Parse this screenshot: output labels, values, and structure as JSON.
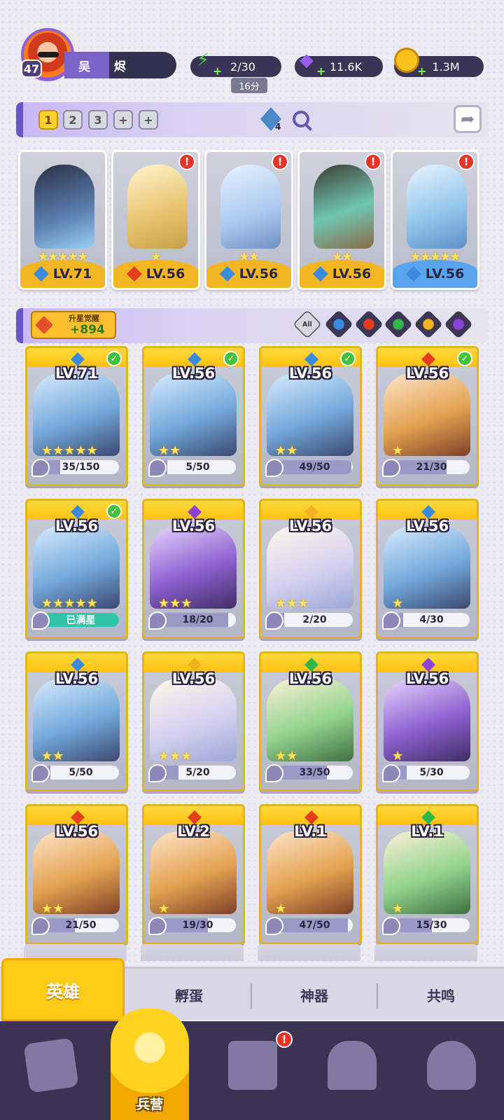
{
  "player": {
    "level": "47",
    "name": "吴 烬"
  },
  "resources": {
    "stamina": "2/30",
    "stamina_timer": "16分",
    "gems": "11.6K",
    "coins": "1.3M"
  },
  "team": {
    "tabs": [
      "1",
      "2",
      "3",
      "+",
      "+"
    ],
    "gem_count": "4",
    "cards": [
      {
        "level": "LV.71",
        "stars": "★★★★★",
        "element": "water",
        "alert": false
      },
      {
        "level": "LV.56",
        "stars": "★",
        "element": "fire",
        "alert": true
      },
      {
        "level": "LV.56",
        "stars": "★★",
        "element": "water",
        "alert": true
      },
      {
        "level": "LV.56",
        "stars": "★★",
        "element": "water",
        "alert": true
      },
      {
        "level": "LV.56",
        "stars": "★★★★★",
        "element": "water",
        "alert": true
      }
    ]
  },
  "awaken": {
    "label": "升星觉醒",
    "value": "+894"
  },
  "filters": {
    "all_label": "All",
    "elements": [
      "water",
      "fire",
      "earth",
      "light",
      "dark"
    ]
  },
  "colors": {
    "water": "#3a8ae0",
    "fire": "#e43e1c",
    "earth": "#2eb84a",
    "light": "#f0b31f",
    "dark": "#8a43d9"
  },
  "heroes": [
    {
      "level": "LV.71",
      "element": "water",
      "progress": "35/150",
      "fill": 0.23,
      "checked": true,
      "stars": "★★★★★"
    },
    {
      "level": "LV.56",
      "element": "water",
      "progress": "5/50",
      "fill": 0.1,
      "checked": true,
      "stars": "★★"
    },
    {
      "level": "LV.56",
      "element": "water",
      "progress": "49/50",
      "fill": 0.98,
      "checked": true,
      "stars": "★★"
    },
    {
      "level": "LV.56",
      "element": "fire",
      "progress": "21/30",
      "fill": 0.7,
      "checked": true,
      "stars": "★"
    },
    {
      "level": "LV.56",
      "element": "water",
      "progress": "已满星",
      "fill": 1,
      "checked": true,
      "stars": "★★★★★",
      "full": true
    },
    {
      "level": "LV.56",
      "element": "dark",
      "progress": "18/20",
      "fill": 0.9,
      "checked": false,
      "stars": "★★★"
    },
    {
      "level": "LV.56",
      "element": "light",
      "progress": "2/20",
      "fill": 0.1,
      "checked": false,
      "stars": "★★★"
    },
    {
      "level": "LV.56",
      "element": "water",
      "progress": "4/30",
      "fill": 0.13,
      "checked": false,
      "stars": "★"
    },
    {
      "level": "LV.56",
      "element": "water",
      "progress": "5/50",
      "fill": 0.1,
      "checked": false,
      "stars": "★★"
    },
    {
      "level": "LV.56",
      "element": "light",
      "progress": "5/20",
      "fill": 0.25,
      "checked": false,
      "stars": "★★★"
    },
    {
      "level": "LV.56",
      "element": "earth",
      "progress": "33/50",
      "fill": 0.66,
      "checked": false,
      "stars": "★★"
    },
    {
      "level": "LV.56",
      "element": "dark",
      "progress": "5/30",
      "fill": 0.17,
      "checked": false,
      "stars": "★"
    },
    {
      "level": "LV.56",
      "element": "fire",
      "progress": "21/50",
      "fill": 0.42,
      "checked": false,
      "stars": "★★"
    },
    {
      "level": "LV.2",
      "element": "fire",
      "progress": "19/30",
      "fill": 0.63,
      "checked": false,
      "stars": "★"
    },
    {
      "level": "LV.1",
      "element": "fire",
      "progress": "47/50",
      "fill": 0.94,
      "checked": false,
      "stars": "★"
    },
    {
      "level": "LV.1",
      "element": "earth",
      "progress": "15/30",
      "fill": 0.5,
      "checked": false,
      "stars": "★"
    }
  ],
  "sub_tabs": [
    "英雄",
    "孵蛋",
    "神器",
    "共鸣"
  ],
  "nav": {
    "active_label": "兵营",
    "items": [
      "cards-icon",
      "barracks-icon",
      "map-icon",
      "shrine-icon",
      "mushroom-icon"
    ]
  }
}
